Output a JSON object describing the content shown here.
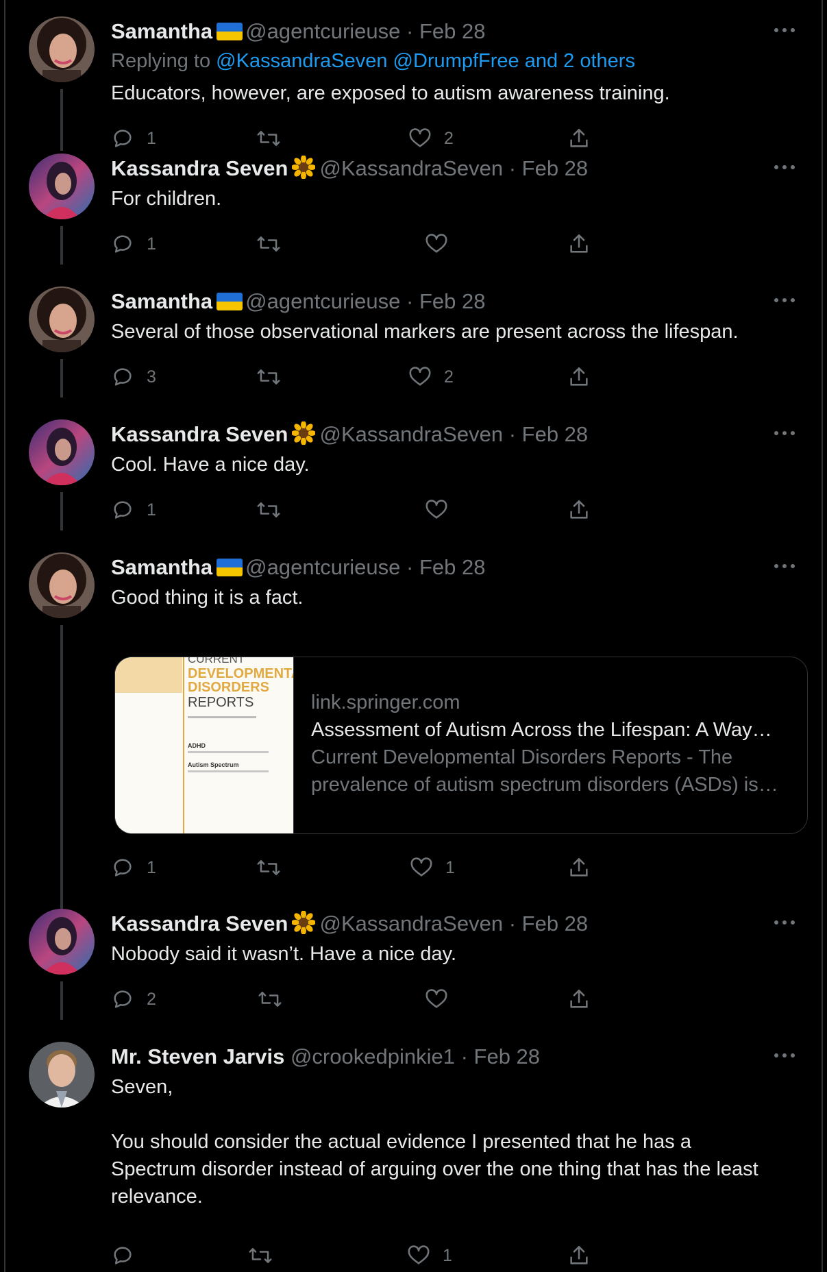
{
  "tweets": [
    {
      "name": "Samantha",
      "handle": "@agentcurieuse",
      "sep": "·",
      "date": "Feb 28",
      "replying_prefix": "Replying to",
      "replying_to": "@KassandraSeven @DrumpfFree and 2 others",
      "text": "Educators, however, are exposed to autism awareness training.",
      "replies": "1",
      "retweets": "",
      "likes": "2",
      "badge": "ukraine-flag"
    },
    {
      "name": "Kassandra Seven",
      "handle": "@KassandraSeven",
      "sep": "·",
      "date": "Feb 28",
      "text": "For children.",
      "replies": "1",
      "retweets": "",
      "likes": "",
      "badge": "sunflower"
    },
    {
      "name": "Samantha",
      "handle": "@agentcurieuse",
      "sep": "·",
      "date": "Feb 28",
      "text": "Several of those observational markers are present across the lifespan.",
      "replies": "3",
      "retweets": "",
      "likes": "2",
      "badge": "ukraine-flag"
    },
    {
      "name": "Kassandra Seven",
      "handle": "@KassandraSeven",
      "sep": "·",
      "date": "Feb 28",
      "text": "Cool. Have a nice day.",
      "replies": "1",
      "retweets": "",
      "likes": "",
      "badge": "sunflower"
    },
    {
      "name": "Samantha",
      "handle": "@agentcurieuse",
      "sep": "·",
      "date": "Feb 28",
      "text": "Good thing it is a fact.",
      "replies": "1",
      "retweets": "",
      "likes": "1",
      "badge": "ukraine-flag",
      "card": {
        "domain": "link.springer.com",
        "title": "Assessment of Autism Across the Lifespan: A Way…",
        "description_line1": "Current Developmental Disorders Reports - The",
        "description_line2": "prevalence of autism spectrum disorders (ASDs) is…",
        "thumb_lines": [
          "CURRENT",
          "DEVELOPMENTAL",
          "DISORDERS",
          "REPORTS",
          "ADHD",
          "Autism Spectrum"
        ]
      }
    },
    {
      "name": "Kassandra Seven",
      "handle": "@KassandraSeven",
      "sep": "·",
      "date": "Feb 28",
      "text": "Nobody said it wasn’t. Have a nice day.",
      "replies": "2",
      "retweets": "",
      "likes": "",
      "badge": "sunflower"
    },
    {
      "name": "Mr. Steven Jarvis",
      "handle": "@crookedpinkie1",
      "sep": "·",
      "date": "Feb 28",
      "text_line1": "Seven,",
      "text_line2": "You should consider the actual evidence I presented that he has a",
      "text_line3": "Spectrum disorder instead of arguing over the one thing that has the least",
      "text_line4": "relevance.",
      "replies": "",
      "retweets": "",
      "likes": "1",
      "badge": ""
    }
  ],
  "icons": {
    "reply": "reply-icon",
    "retweet": "retweet-icon",
    "like": "heart-icon",
    "share": "share-icon",
    "more": "more-icon"
  },
  "colors": {
    "background": "#000000",
    "text": "#e7e9ea",
    "muted": "#71767b",
    "link": "#1d9bf0",
    "thread_line": "#333639"
  }
}
